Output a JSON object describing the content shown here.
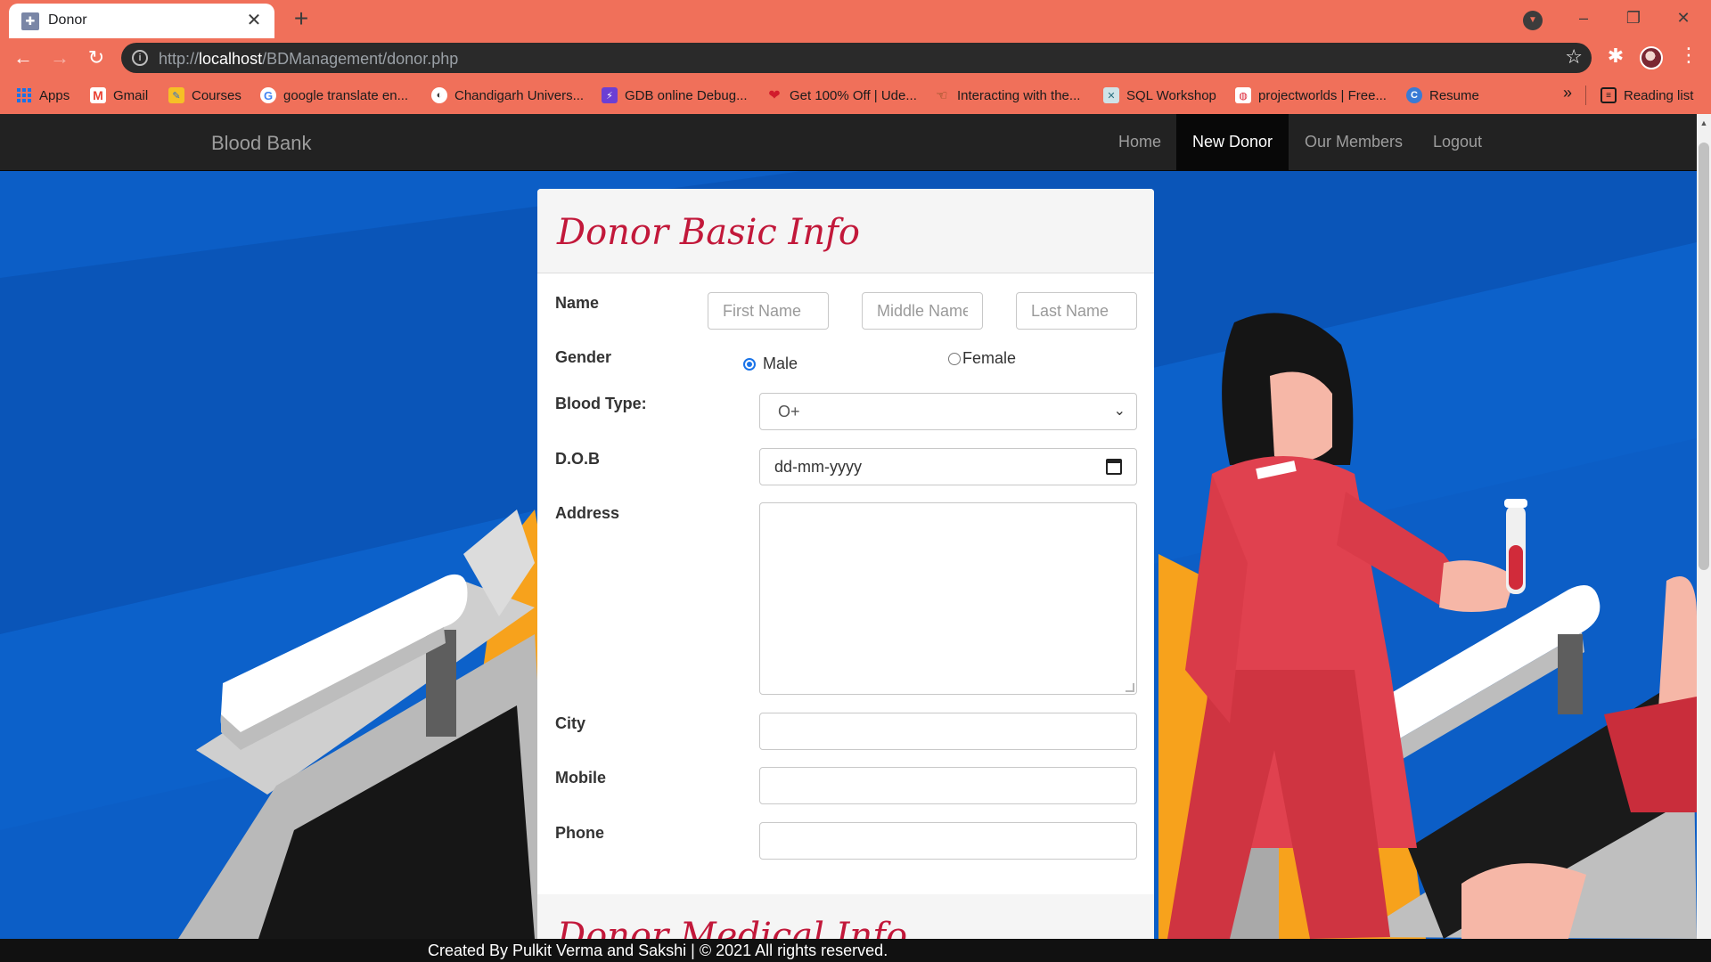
{
  "browser": {
    "tab_title": "Donor",
    "url_prefix": "http://",
    "url_host": "localhost",
    "url_path": "/BDManagement/donor.php",
    "bookmarks": [
      {
        "label": "Apps",
        "icon": "apps-grid-icon"
      },
      {
        "label": "Gmail",
        "icon": "gmail-icon"
      },
      {
        "label": "Courses",
        "icon": "courses-icon"
      },
      {
        "label": "google translate en...",
        "icon": "google-icon"
      },
      {
        "label": "Chandigarh Univers...",
        "icon": "globe-icon"
      },
      {
        "label": "GDB online Debug...",
        "icon": "gdb-icon"
      },
      {
        "label": "Get 100% Off | Ude...",
        "icon": "heart-icon"
      },
      {
        "label": "Interacting with the...",
        "icon": "hand-icon"
      },
      {
        "label": "SQL Workshop",
        "icon": "sql-icon"
      },
      {
        "label": "projectworlds | Free...",
        "icon": "projectworlds-icon"
      },
      {
        "label": "Resume",
        "icon": "resume-icon"
      }
    ],
    "more_bookmarks": "»",
    "reading_list": "Reading list",
    "accent": "#f0705a"
  },
  "site": {
    "brand": "Blood Bank",
    "nav": [
      {
        "label": "Home",
        "active": false
      },
      {
        "label": "New Donor",
        "active": true
      },
      {
        "label": "Our Members",
        "active": false
      },
      {
        "label": "Logout",
        "active": false
      }
    ],
    "background": "#0c5ec6"
  },
  "form": {
    "heading": "Donor Basic Info",
    "labels": {
      "name": "Name",
      "gender": "Gender",
      "blood_type": "Blood Type:",
      "dob": "D.O.B",
      "address": "Address",
      "city": "City",
      "mobile": "Mobile",
      "phone": "Phone"
    },
    "placeholders": {
      "first_name": "First Name",
      "middle_name": "Middle Name",
      "last_name": "Last Name"
    },
    "gender_options": [
      "Male",
      "Female"
    ],
    "gender_selected": "Male",
    "blood_type_value": "O+",
    "dob_placeholder": "dd-mm-yyyy",
    "address_value": "",
    "city_value": "",
    "mobile_value": "",
    "phone_value": "",
    "heading_color": "#c2183a",
    "medical_heading": "Donor Medical Info"
  },
  "footer": {
    "text": "Created By Pulkit Verma and Sakshi | © 2021 All rights reserved."
  }
}
